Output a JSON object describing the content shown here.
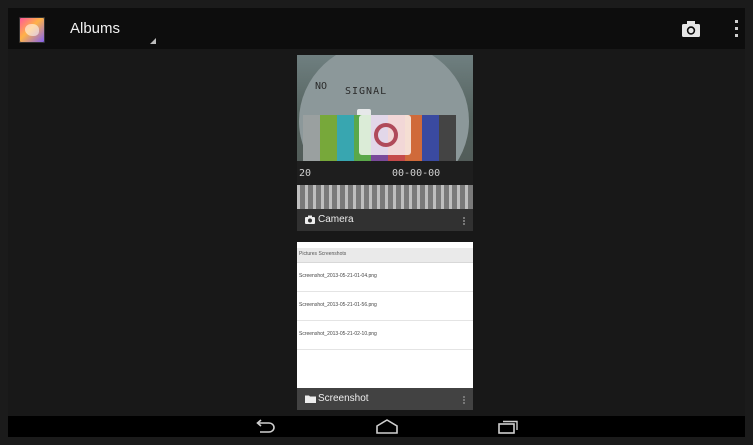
{
  "actionbar": {
    "app_icon": "gallery-app-icon",
    "spinner_label": "Albums",
    "camera_icon": "camera-icon",
    "overflow_icon": "overflow-menu-icon"
  },
  "albums": [
    {
      "name": "Camera",
      "icon": "camera-icon",
      "thumbnail": {
        "text_top_left": "NO",
        "text_top": "SIGNAL",
        "timecode": "00-00-00",
        "left_number": "20"
      }
    },
    {
      "name": "Screenshot",
      "icon": "folder-icon",
      "thumbnail": {
        "breadcrumb": "Pictures  Screenshots",
        "rows": [
          "Screenshot_2013-05-21-01-04.png",
          "Screenshot_2013-05-21-01-56.png",
          "Screenshot_2013-05-21-02-10.png"
        ]
      }
    }
  ],
  "navbar": {
    "back_icon": "back-icon",
    "home_icon": "home-icon",
    "recents_icon": "recent-apps-icon"
  },
  "colors": {
    "actionbar_bg": "#0d0d0d",
    "content_bg": "#181818",
    "navbar_bg": "#000000"
  }
}
